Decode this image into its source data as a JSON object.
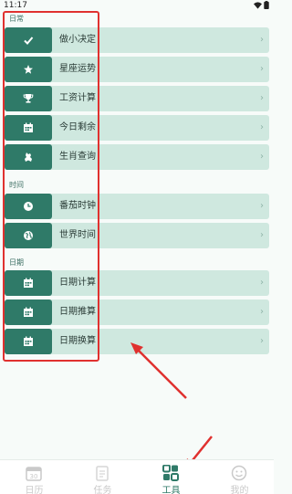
{
  "status_bar": {
    "time": "11:17",
    "icons": [
      "wifi-icon",
      "battery-icon"
    ]
  },
  "sections": {
    "daily": {
      "label": "日常",
      "items": [
        {
          "label": "做小决定",
          "icon": "check-icon"
        },
        {
          "label": "星座运势",
          "icon": "star-icon"
        },
        {
          "label": "工资计算",
          "icon": "trophy-icon"
        },
        {
          "label": "今日剩余",
          "icon": "calendar-icon"
        },
        {
          "label": "生肖查询",
          "icon": "zodiac-icon"
        }
      ]
    },
    "time": {
      "label": "时间",
      "items": [
        {
          "label": "番茄时钟",
          "icon": "clock-icon"
        },
        {
          "label": "世界时间",
          "icon": "globe-icon"
        }
      ]
    },
    "date": {
      "label": "日期",
      "items": [
        {
          "label": "日期计算",
          "icon": "calendar-icon"
        },
        {
          "label": "日期推算",
          "icon": "calendar-icon"
        },
        {
          "label": "日期换算",
          "icon": "calendar-icon"
        }
      ]
    }
  },
  "chevron": "›",
  "tabbar": {
    "calendar_badge": "30",
    "tabs": [
      {
        "label": "日历",
        "icon": "calendar-tab-icon",
        "active": false
      },
      {
        "label": "任务",
        "icon": "task-tab-icon",
        "active": false
      },
      {
        "label": "工具",
        "icon": "tools-tab-icon",
        "active": true
      },
      {
        "label": "我的",
        "icon": "profile-tab-icon",
        "active": false
      }
    ]
  },
  "colors": {
    "accent": "#2f7a68",
    "row_background": "#cfe8df",
    "page_background": "#f7fbf9",
    "annotation_red": "#e0312f"
  }
}
